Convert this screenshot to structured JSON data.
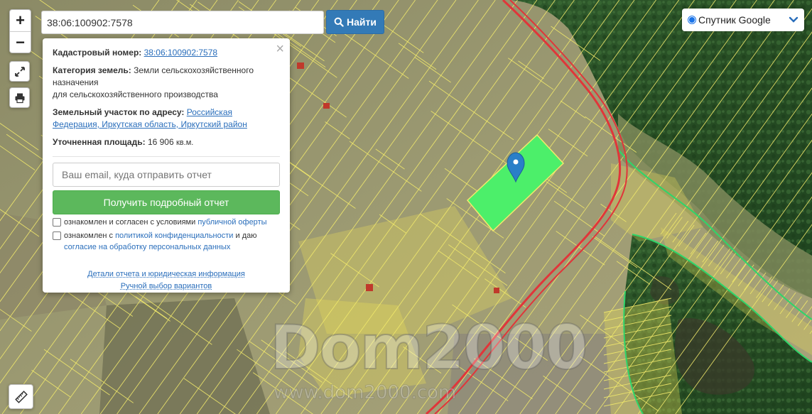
{
  "search": {
    "value": "38:06:100902:7578"
  },
  "find_button": {
    "label": "Найти"
  },
  "layer": {
    "label": "Спутник Google"
  },
  "zoom": {
    "in": "+",
    "out": "−"
  },
  "popup": {
    "cad_label": "Кадастровый номер:",
    "cad_value": "38:06:100902:7578",
    "cat_label": "Категория земель:",
    "cat_value_1": "Земли сельскохозяйственного",
    "cat_value_2": "назначения",
    "cat_value_3": "для сельскохозяйственного производства",
    "addr_label": "Земельный участок по адресу:",
    "addr_link_1": "Российская",
    "addr_link_2": "Федерация, Иркутская область, Иркутский район",
    "area_label": "Уточненная площадь:",
    "area_value": "16 906",
    "area_unit": "кв.м.",
    "email_placeholder": "Ваш email, куда отправить отчет",
    "report_button": "Получить подробный отчет",
    "agree1_text": "ознакомлен и согласен с условиями",
    "agree1_link": "публичной оферты",
    "agree2_text": "ознакомлен с",
    "agree2_link": "политикой конфиденциальности",
    "agree2_text2": "и даю",
    "agree2_link2": "согласие на обработку персональных данных",
    "details_link": "Детали отчета и юридическая информация",
    "manual_link": "Ручной выбор вариантов",
    "close": "×"
  },
  "watermark": {
    "big": "Dom2000",
    "small": "www.dom2000.com"
  },
  "colors": {
    "parcel_highlight": "#4cef6a",
    "parcel_border": "#f1e96b",
    "road": "#e0363a",
    "forest_border": "#2fd56a",
    "marker": "#2a7fc8"
  }
}
